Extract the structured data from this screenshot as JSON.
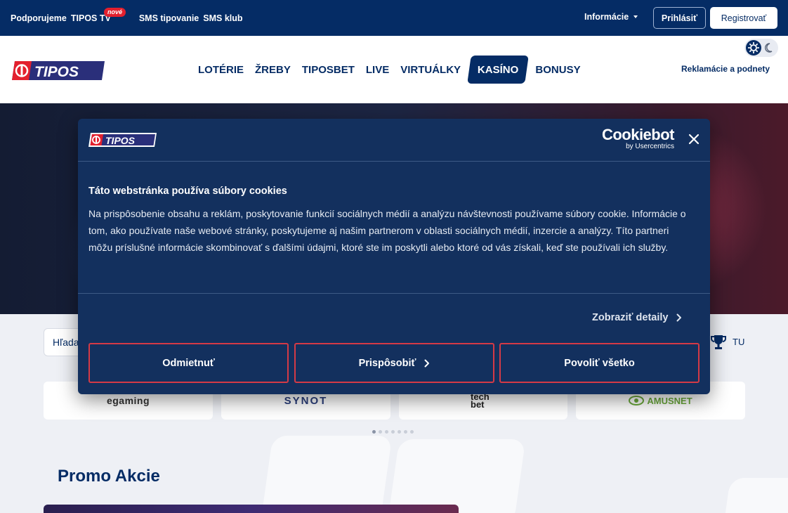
{
  "topbar": {
    "links": [
      "Podporujeme",
      "TIPOS TV",
      "SMS tipovanie",
      "SMS klub"
    ],
    "new_badge": "nové",
    "info_dropdown": "Informácie",
    "login_button": "Prihlásiť",
    "register_button": "Registrovať"
  },
  "header": {
    "logo_text": "TIPOS",
    "nav": [
      "LOTÉRIE",
      "ŽREBY",
      "TIPOSBET",
      "LIVE",
      "VIRTUÁLKY",
      "KASÍNO",
      "BONUSY"
    ],
    "active_nav": "KASÍNO",
    "complaints_link": "Reklamácie a podnety"
  },
  "casino": {
    "search_placeholder": "Hľadať",
    "tournament_label": "TU",
    "providers": [
      "egaming",
      "SYNOT",
      "tech bet",
      "AMUSNET"
    ],
    "promo_title": "Promo Akcie"
  },
  "cookie_dialog": {
    "logo_text": "TIPOS",
    "cookiebot_brand": "Cookiebot",
    "cookiebot_sub": "by Usercentrics",
    "title": "Táto webstránka používa súbory cookies",
    "body": "Na prispôsobenie obsahu a reklám, poskytovanie funkcií sociálnych médií a analýzu návštevnosti používame súbory cookie. Informácie o tom, ako používate naše webové stránky, poskytujeme aj našim partnerom v oblasti sociálnych médií, inzercie a analýzy. Títo partneri môžu príslušné informácie skombinovať s ďalšími údajmi, ktoré ste im poskytli alebo ktoré od vás získali, keď ste používali ich služby.",
    "details_link": "Zobraziť detaily",
    "deny_button": "Odmietnuť",
    "customize_button": "Prispôsobiť",
    "allow_button": "Povoliť všetko"
  },
  "colors": {
    "brand_navy": "#052c65",
    "dialog_bg": "#13305e",
    "accent_red": "#d43a46"
  }
}
